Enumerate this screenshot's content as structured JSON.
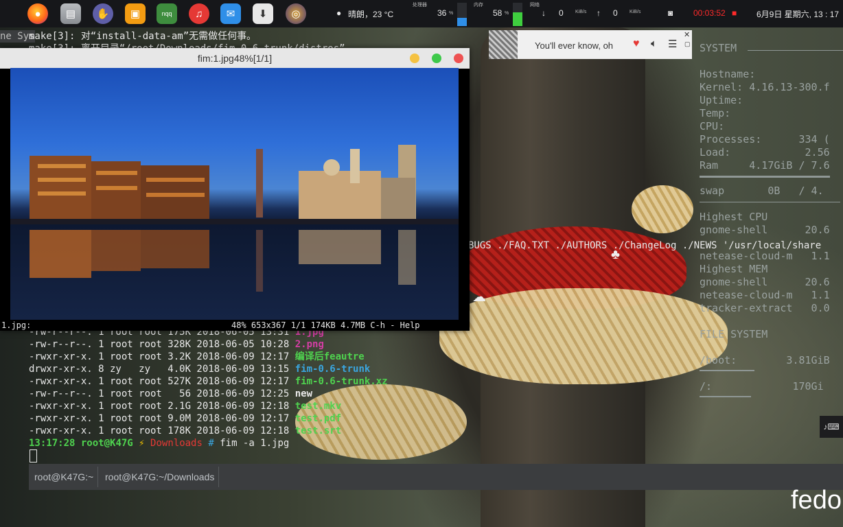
{
  "panel": {
    "weather": "晴朗，23 °C",
    "cpu_label": "处理器",
    "cpu_value": "36",
    "cpu_unit": "%",
    "cpu_level": 0.36,
    "mem_label": "内存",
    "mem_value": "58",
    "mem_unit": "%",
    "mem_level": 0.58,
    "net_label": "网络",
    "net_down": "0",
    "net_down_unit": "KiB/s",
    "net_up": "0",
    "net_up_unit": "KiB/s",
    "timer": "00:03:52",
    "datetime": "6月9日 星期六, 13 : 17",
    "launcher_icons": [
      "firefox-icon",
      "files-icon",
      "gnome-icon",
      "workspace-icon",
      "nqq-icon",
      "netease-music-icon",
      "chat-icon",
      "software-center-icon",
      "browser-icon"
    ],
    "accent_timer": "#ff2a2a"
  },
  "terminal": {
    "prev_left": "ne Sys",
    "lines_top": [
      "make[3]: 对“install-data-am”无需做任何事。",
      "make[3]: 离开目录“/root/Downloads/fim-0.6-trunk/distros”"
    ],
    "stray_text": "BUGS ./FAQ.TXT ./AUTHORS ./ChangeLog ./NEWS '/usr/local/share",
    "listing": [
      {
        "perm": "-rw-r--r--.",
        "links": "1",
        "user": "root",
        "group": "root",
        "size": "175K",
        "date": "2018-06-05 13:31",
        "name": "1.jpg",
        "color": "#d43ea4"
      },
      {
        "perm": "-rw-r--r--.",
        "links": "1",
        "user": "root",
        "group": "root",
        "size": "328K",
        "date": "2018-06-05 10:28",
        "name": "2.png",
        "color": "#d43ea4"
      },
      {
        "perm": "-rwxr-xr-x.",
        "links": "1",
        "user": "root",
        "group": "root",
        "size": "3.2K",
        "date": "2018-06-09 12:17",
        "name": "编译后feautre",
        "color": "#4fd34f"
      },
      {
        "perm": "drwxr-xr-x.",
        "links": "8",
        "user": "zy",
        "group": "zy",
        "size": "4.0K",
        "date": "2018-06-09 13:15",
        "name": "fim-0.6-trunk",
        "color": "#3aa6e0"
      },
      {
        "perm": "-rwxr-xr-x.",
        "links": "1",
        "user": "root",
        "group": "root",
        "size": "527K",
        "date": "2018-06-09 12:17",
        "name": "fim-0.6-trunk.xz",
        "color": "#4fd34f"
      },
      {
        "perm": "-rw-r--r--.",
        "links": "1",
        "user": "root",
        "group": "root",
        "size": "56",
        "date": "2018-06-09 12:25",
        "name": "new",
        "color": "#e9e9e9"
      },
      {
        "perm": "-rwxr-xr-x.",
        "links": "1",
        "user": "root",
        "group": "root",
        "size": "2.1G",
        "date": "2018-06-09 12:18",
        "name": "test.mkv",
        "color": "#4fd34f"
      },
      {
        "perm": "-rwxr-xr-x.",
        "links": "1",
        "user": "root",
        "group": "root",
        "size": "9.0M",
        "date": "2018-06-09 12:17",
        "name": "test.pdf",
        "color": "#4fd34f"
      },
      {
        "perm": "-rwxr-xr-x.",
        "links": "1",
        "user": "root",
        "group": "root",
        "size": "178K",
        "date": "2018-06-09 12:18",
        "name": "test.srt",
        "color": "#4fd34f"
      }
    ],
    "prompt": {
      "time": "13:17:28",
      "host": "root@K47G",
      "bolt": "⚡",
      "dir": "Downloads",
      "hash": "#",
      "command": "fim -a 1.jpg"
    },
    "tabs": [
      "root@K47G:~",
      "root@K47G:~/Downloads"
    ]
  },
  "fim": {
    "title": "fim:1.jpg48%[1/1]",
    "status_left": "1.jpg:",
    "status_right": "48% 653x367 1/1 174KB 4.7MB  C-h - Help"
  },
  "music": {
    "song": "You'll ever know, oh"
  },
  "conky": {
    "system_header": "SYSTEM",
    "hostname_label": "Hostname:",
    "kernel": "Kernel: 4.16.13-300.f",
    "uptime_label": "Uptime:",
    "temp_label": "Temp:",
    "cpu_label": "CPU:",
    "processes": "Processes:      334 (",
    "load": "Load:            2.56",
    "ram": "Ram     4.17GiB / 7.6",
    "swap": "swap       0B   / 4.",
    "highest_cpu": "Highest CPU",
    "cpu_proc1": "gnome-shell      20.6",
    "cpu_proc2": "netease-cloud-m   1.1",
    "highest_mem": "Highest MEM",
    "mem_proc1": "gnome-shell      20.6",
    "mem_proc2": "netease-cloud-m   1.1",
    "mem_proc3": "tracker-extract   0.0",
    "fs_header": "FILE SYSTEM",
    "fs_boot": "/boot:        3.81GiB",
    "fs_root": "/:             170Gi"
  },
  "brand": "fedo"
}
